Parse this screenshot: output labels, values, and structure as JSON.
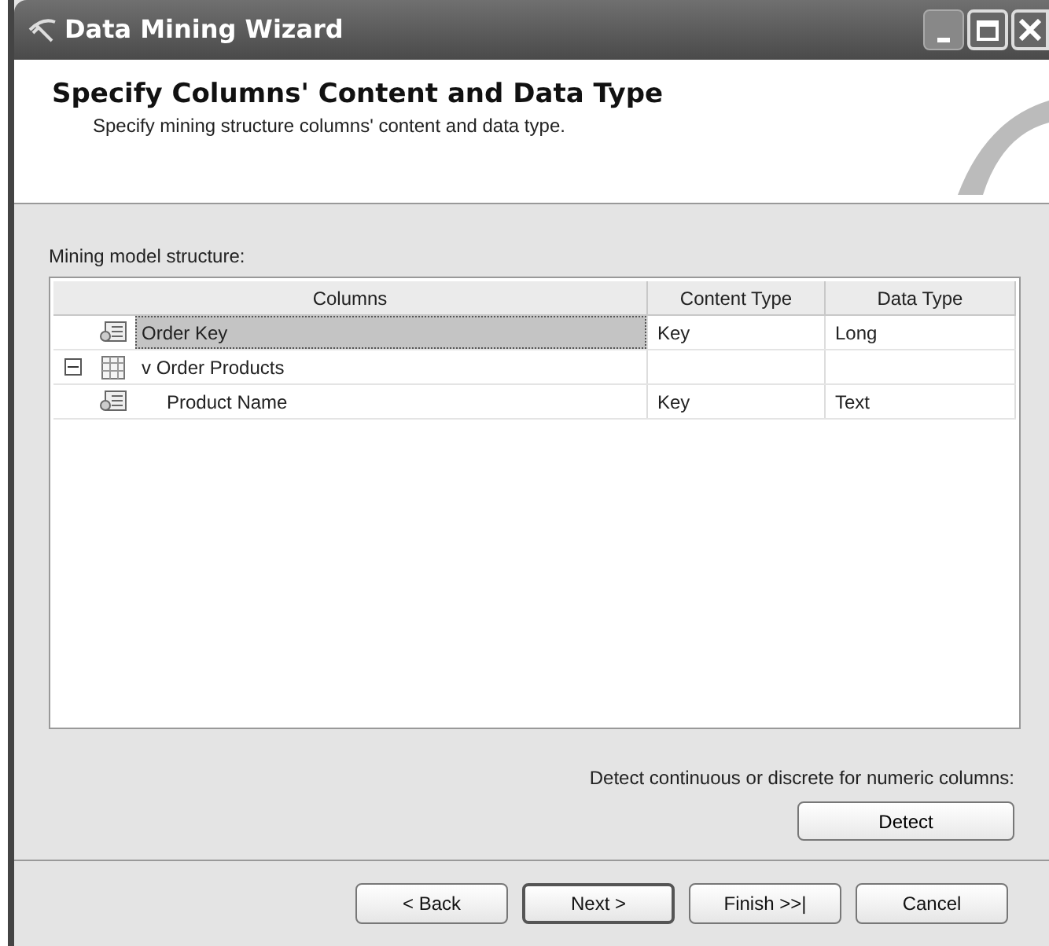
{
  "window": {
    "title": "Data Mining Wizard"
  },
  "header": {
    "title": "Specify Columns' Content and Data Type",
    "subtitle": "Specify mining structure columns' content and data type."
  },
  "grid_label": "Mining model structure:",
  "grid": {
    "columns": [
      "Columns",
      "Content Type",
      "Data Type"
    ],
    "rows": [
      {
        "kind": "column",
        "name": "Order Key",
        "content_type": "Key",
        "data_type": "Long",
        "selected": true
      },
      {
        "kind": "table",
        "name": "v Order Products",
        "expanded": true,
        "selected": false,
        "children": [
          {
            "kind": "column",
            "name": "Product Name",
            "content_type": "Key",
            "data_type": "Text",
            "selected": false
          }
        ]
      }
    ]
  },
  "detect": {
    "text": "Detect continuous or discrete for numeric columns:",
    "button": "Detect"
  },
  "buttons": [
    {
      "label": "< Back",
      "default": false
    },
    {
      "label": "Next >",
      "default": true
    },
    {
      "label": "Finish >>|",
      "default": false
    },
    {
      "label": "Cancel",
      "default": false
    }
  ]
}
